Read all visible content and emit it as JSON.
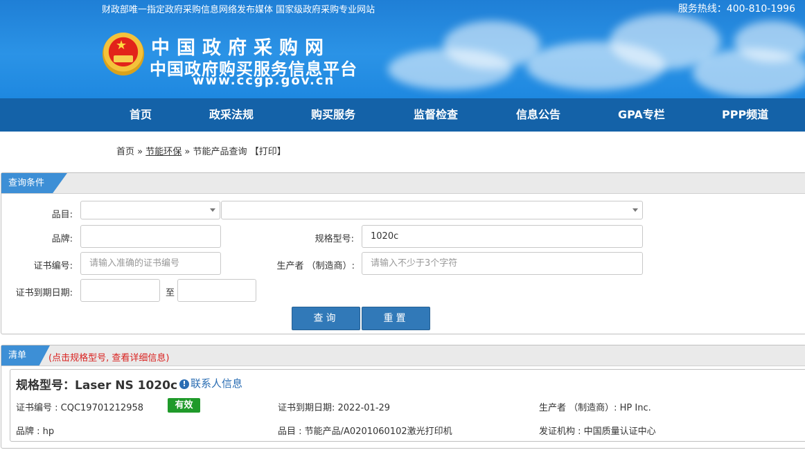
{
  "header": {
    "tagline": "财政部唯一指定政府采购信息网络发布媒体 国家级政府采购专业网站",
    "hotline": "服务热线：400-810-1996",
    "logo_title": "中国政府采购网",
    "logo_subtitle": "中国政府购买服务信息平台",
    "logo_url": "www.ccgp.gov.cn"
  },
  "nav": [
    "首页",
    "政采法规",
    "购买服务",
    "监督检查",
    "信息公告",
    "GPA专栏",
    "PPP频道"
  ],
  "breadcrumb": {
    "home": "首页",
    "sep1": "»",
    "section": "节能环保",
    "sep2": "»",
    "current": "节能产品查询",
    "print": "【打印】"
  },
  "query": {
    "title": "查询条件",
    "category_label": "品目:",
    "brand_label": "品牌:",
    "brand_value": "",
    "model_label": "规格型号:",
    "model_value": "1020c",
    "cert_no_label": "证书编号:",
    "cert_no_placeholder": "请输入准确的证书编号",
    "maker_label": "生产者 （制造商）:",
    "maker_placeholder": "请输入不少于3个字符",
    "expiry_label": "证书到期日期:",
    "expiry_to": "至",
    "search_button": "查询",
    "reset_button": "重置"
  },
  "results": {
    "title": "清单",
    "tip": "(点击规格型号, 查看详细信息)",
    "items": [
      {
        "model": "规格型号：Laser NS 1020c",
        "contact": "联系人信息",
        "cert_no": "证书编号 : CQC19701212958",
        "status": "有效",
        "expiry": "证书到期日期: 2022-01-29",
        "maker": "生产者 （制造商）: HP Inc.",
        "brand": "品牌 : hp",
        "category": "品目 : 节能产品/A0201060102激光打印机",
        "issuer": "发证机构 : 中国质量认证中心"
      }
    ]
  },
  "colors": {
    "nav_bg": "#1462a8",
    "header_bg": "#1f7fd6",
    "tag_bg": "#3d8fd6",
    "button_bg": "#3179b8",
    "status_valid": "#1f9a2a",
    "tip_red": "#d9211f",
    "link_blue": "#2a6db3"
  }
}
